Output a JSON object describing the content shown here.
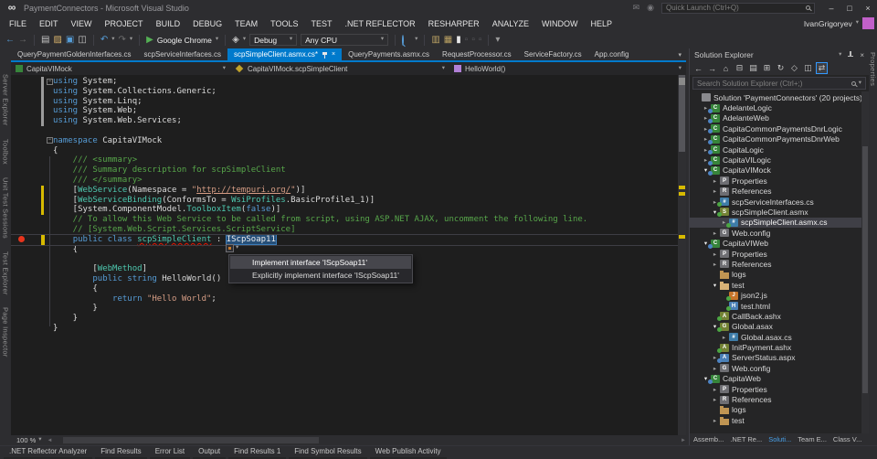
{
  "window": {
    "title": "PaymentConnectors - Microsoft Visual Studio"
  },
  "titlebar": {
    "quick_launch_placeholder": "Quick Launch (Ctrl+Q)"
  },
  "user": {
    "name": "IvanGrigoryev"
  },
  "menus": [
    "FILE",
    "EDIT",
    "VIEW",
    "PROJECT",
    "BUILD",
    "DEBUG",
    "TEAM",
    "TOOLS",
    "TEST",
    ".NET REFLECTOR",
    "RESHARPER",
    "ANALYZE",
    "WINDOW",
    "HELP"
  ],
  "toolbar": {
    "items": [
      {
        "k": "icon",
        "name": "navigate-back-icon",
        "g": "←",
        "tint": "#569CD6"
      },
      {
        "k": "icon",
        "name": "navigate-forward-icon",
        "g": "→",
        "tint": "#6E6E6E"
      },
      {
        "k": "sep"
      },
      {
        "k": "icon",
        "name": "new-file-icon",
        "g": "▤",
        "tint": "#C8C8C8"
      },
      {
        "k": "icon",
        "name": "open-file-icon",
        "g": "▨",
        "tint": "#D9B36C"
      },
      {
        "k": "icon",
        "name": "save-icon",
        "g": "▣",
        "tint": "#569CD6"
      },
      {
        "k": "icon",
        "name": "save-all-icon",
        "g": "◫",
        "tint": "#C8C8C8"
      },
      {
        "k": "sep"
      },
      {
        "k": "icon",
        "name": "undo-icon",
        "g": "↶",
        "tint": "#569CD6"
      },
      {
        "k": "caret"
      },
      {
        "k": "icon",
        "name": "redo-icon",
        "g": "↷",
        "tint": "#6E6E6E"
      },
      {
        "k": "caret"
      },
      {
        "k": "sep"
      },
      {
        "k": "icon",
        "name": "start-debug-icon",
        "g": "▶",
        "tint": "#54B054"
      },
      {
        "k": "runlabel",
        "label": "Google Chrome"
      },
      {
        "k": "caret"
      },
      {
        "k": "sep"
      },
      {
        "k": "icon",
        "name": "browse-with-icon",
        "g": "◈",
        "tint": "#C8C8C8"
      },
      {
        "k": "caret"
      },
      {
        "k": "combo",
        "name": "solution-configuration-dropdown",
        "label": "Debug",
        "w": 52
      },
      {
        "k": "combo",
        "name": "solution-platform-dropdown",
        "label": "Any CPU",
        "w": 96
      },
      {
        "k": "sep"
      },
      {
        "k": "mag",
        "name": "find-in-files-icon"
      },
      {
        "k": "caret"
      },
      {
        "k": "sep"
      },
      {
        "k": "icon",
        "name": "solution-scope-icon",
        "g": "▥",
        "tint": "#B9A063"
      },
      {
        "k": "icon",
        "name": "file-scope-icon",
        "g": "▦",
        "tint": "#B9A063"
      },
      {
        "k": "icon",
        "name": "bookmark-icon",
        "g": "▮",
        "tint": "#E8E8E8"
      },
      {
        "k": "icon",
        "name": "comment-icon",
        "g": "▫",
        "tint": "#5E5E63"
      },
      {
        "k": "icon",
        "name": "uncomment-icon",
        "g": "▫",
        "tint": "#5E5E63"
      },
      {
        "k": "icon",
        "name": "indent-icon",
        "g": "▫",
        "tint": "#5E5E63"
      },
      {
        "k": "sep"
      },
      {
        "k": "icon",
        "name": "toolbar-overflow-icon",
        "g": "▾",
        "tint": "#999999"
      }
    ]
  },
  "left_tool_tabs": [
    "Server Explorer",
    "Toolbox",
    "Unit Test Sessions",
    "Test Explorer",
    "Page Inspector"
  ],
  "right_tool_tabs": [
    "Properties"
  ],
  "doc_tabs": [
    {
      "label": "QueryPaymentGoldenInterfaces.cs",
      "active": false
    },
    {
      "label": "scpServiceInterfaces.cs",
      "active": false
    },
    {
      "label": "scpSimpleClient.asmx.cs*",
      "active": true
    },
    {
      "label": "QueryPayments.asmx.cs",
      "active": false
    },
    {
      "label": "RequestProcessor.cs",
      "active": false
    },
    {
      "label": "ServiceFactory.cs",
      "active": false
    },
    {
      "label": "App.config",
      "active": false
    }
  ],
  "breadcrumb": {
    "project": "CapitaVIMock",
    "type_name": "CapitaVIMock.scpSimpleClient",
    "member": "HelloWorld()"
  },
  "editor": {
    "zoom_label": "100 %",
    "current_line_index": 16,
    "code_lines": [
      [
        {
          "t": "using",
          "c": "kw"
        },
        {
          "t": " System;",
          "c": "pl"
        }
      ],
      [
        {
          "t": "using",
          "c": "kw"
        },
        {
          "t": " System.Collections.Generic;",
          "c": "pl"
        }
      ],
      [
        {
          "t": "using",
          "c": "kw"
        },
        {
          "t": " System.Linq;",
          "c": "pl"
        }
      ],
      [
        {
          "t": "using",
          "c": "kw"
        },
        {
          "t": " System.Web;",
          "c": "pl"
        }
      ],
      [
        {
          "t": "using",
          "c": "kw"
        },
        {
          "t": " System.Web.Services;",
          "c": "pl"
        }
      ],
      [],
      [
        {
          "t": "namespace",
          "c": "kw"
        },
        {
          "t": " CapitaVIMock",
          "c": "pl"
        }
      ],
      [
        {
          "t": "{",
          "c": "pl"
        }
      ],
      [
        {
          "t": "    /// <summary>",
          "c": "cm"
        }
      ],
      [
        {
          "t": "    /// Summary description for scpSimpleClient",
          "c": "cm"
        }
      ],
      [
        {
          "t": "    /// </summary>",
          "c": "cm"
        }
      ],
      [
        {
          "t": "    [",
          "c": "pl"
        },
        {
          "t": "WebService",
          "c": "ty"
        },
        {
          "t": "(Namespace = ",
          "c": "pl"
        },
        {
          "t": "\"",
          "c": "st"
        },
        {
          "t": "http://tempuri.org/",
          "c": "lk"
        },
        {
          "t": "\"",
          "c": "st"
        },
        {
          "t": ")]",
          "c": "pl"
        }
      ],
      [
        {
          "t": "    [",
          "c": "pl"
        },
        {
          "t": "WebServiceBinding",
          "c": "ty"
        },
        {
          "t": "(ConformsTo = ",
          "c": "pl"
        },
        {
          "t": "WsiProfiles",
          "c": "ty"
        },
        {
          "t": ".BasicProfile1_1)]",
          "c": "pl"
        }
      ],
      [
        {
          "t": "    [System.ComponentModel.",
          "c": "pl"
        },
        {
          "t": "ToolboxItem",
          "c": "ty"
        },
        {
          "t": "(",
          "c": "pl"
        },
        {
          "t": "false",
          "c": "kw"
        },
        {
          "t": ")]",
          "c": "pl"
        }
      ],
      [
        {
          "t": "    // To allow this Web Service to be called from script, using ASP.NET AJAX, uncomment the following line.",
          "c": "cm"
        }
      ],
      [
        {
          "t": "    // [System.Web.Script.Services.ScriptService]",
          "c": "cm"
        }
      ],
      [
        {
          "t": "    ",
          "c": "pl"
        },
        {
          "t": "public class",
          "c": "kw"
        },
        {
          "t": " ",
          "c": "pl"
        },
        {
          "t": "scpSimpleClient",
          "c": "er"
        },
        {
          "t": " : ",
          "c": "pl"
        },
        {
          "t": "IScpSoap11",
          "c": "sl"
        }
      ],
      [
        {
          "t": "    {",
          "c": "pl"
        }
      ],
      [],
      [
        {
          "t": "        [",
          "c": "pl"
        },
        {
          "t": "WebMethod",
          "c": "ty"
        },
        {
          "t": "]",
          "c": "pl"
        }
      ],
      [
        {
          "t": "        ",
          "c": "pl"
        },
        {
          "t": "public string",
          "c": "kw"
        },
        {
          "t": " HelloWorld()",
          "c": "pl"
        }
      ],
      [
        {
          "t": "        {",
          "c": "pl"
        }
      ],
      [
        {
          "t": "            ",
          "c": "pl"
        },
        {
          "t": "return",
          "c": "kw"
        },
        {
          "t": " ",
          "c": "pl"
        },
        {
          "t": "\"Hello World\"",
          "c": "st"
        },
        {
          "t": ";",
          "c": "pl"
        }
      ],
      [
        {
          "t": "        }",
          "c": "pl"
        }
      ],
      [
        {
          "t": "    }",
          "c": "pl"
        }
      ],
      [
        {
          "t": "}",
          "c": "pl"
        }
      ]
    ]
  },
  "context_menu": {
    "items": [
      {
        "label": "Implement interface 'IScpSoap11'",
        "highlighted": true
      },
      {
        "label": "Explicitly implement interface 'IScpSoap11'",
        "highlighted": false
      }
    ]
  },
  "solution_explorer": {
    "title": "Solution Explorer",
    "search_placeholder": "Search Solution Explorer (Ctrl+;)",
    "toolbar_icons": [
      {
        "name": "back-icon",
        "g": "←"
      },
      {
        "name": "forward-icon",
        "g": "→"
      },
      {
        "name": "home-icon",
        "g": "⌂"
      },
      {
        "name": "collapse-all-icon",
        "g": "⊟"
      },
      {
        "name": "pending-changes-filter-icon",
        "g": "▤"
      },
      {
        "name": "show-all-files-icon",
        "g": "⊞"
      },
      {
        "name": "refresh-icon",
        "g": "↻"
      },
      {
        "name": "view-code-icon",
        "g": "◇"
      },
      {
        "name": "preview-selected-items-icon",
        "g": "◫"
      },
      {
        "name": "sync-with-active-document-icon",
        "g": "⇄",
        "boxed": true
      }
    ],
    "tree": [
      {
        "label": "Solution 'PaymentConnectors' (20 projects)",
        "depth": 0,
        "icon": "sln",
        "arrow": "",
        "sel": false,
        "dot": null
      },
      {
        "label": "AdelanteLogic",
        "depth": 1,
        "icon": "csproj",
        "arrow": "c",
        "sel": false,
        "dot": "blue"
      },
      {
        "label": "AdelanteWeb",
        "depth": 1,
        "icon": "webproj",
        "arrow": "c",
        "sel": false,
        "dot": "blue"
      },
      {
        "label": "CapitaCommonPaymentsDnrLogic",
        "depth": 1,
        "icon": "csproj",
        "arrow": "c",
        "sel": false,
        "dot": "blue"
      },
      {
        "label": "CapitaCommonPaymentsDnrWeb",
        "depth": 1,
        "icon": "webproj",
        "arrow": "c",
        "sel": false,
        "dot": "blue"
      },
      {
        "label": "CapitaLogic",
        "depth": 1,
        "icon": "csproj",
        "arrow": "c",
        "sel": false,
        "dot": "blue"
      },
      {
        "label": "CapitaVILogic",
        "depth": 1,
        "icon": "csproj",
        "arrow": "c",
        "sel": false,
        "dot": "blue"
      },
      {
        "label": "CapitaVIMock",
        "depth": 1,
        "icon": "webproj",
        "arrow": "e",
        "sel": false,
        "dot": "blue"
      },
      {
        "label": "Properties",
        "depth": 2,
        "icon": "props",
        "arrow": "c",
        "sel": false,
        "dot": null
      },
      {
        "label": "References",
        "depth": 2,
        "icon": "refs",
        "arrow": "c",
        "sel": false,
        "dot": null
      },
      {
        "label": "scpServiceInterfaces.cs",
        "depth": 2,
        "icon": "cs",
        "arrow": "c",
        "sel": false,
        "dot": "green"
      },
      {
        "label": "scpSimpleClient.asmx",
        "depth": 2,
        "icon": "asmx",
        "arrow": "e",
        "sel": false,
        "dot": "green"
      },
      {
        "label": "scpSimpleClient.asmx.cs",
        "depth": 3,
        "icon": "cs",
        "arrow": "c",
        "sel": true,
        "dot": "green"
      },
      {
        "label": "Web.config",
        "depth": 2,
        "icon": "config",
        "arrow": "c",
        "sel": false,
        "dot": null
      },
      {
        "label": "CapitaVIWeb",
        "depth": 1,
        "icon": "webproj",
        "arrow": "e",
        "sel": false,
        "dot": "blue"
      },
      {
        "label": "Properties",
        "depth": 2,
        "icon": "props",
        "arrow": "c",
        "sel": false,
        "dot": null
      },
      {
        "label": "References",
        "depth": 2,
        "icon": "refs",
        "arrow": "c",
        "sel": false,
        "dot": null
      },
      {
        "label": "logs",
        "depth": 2,
        "icon": "folder",
        "arrow": "",
        "sel": false,
        "dot": null
      },
      {
        "label": "test",
        "depth": 2,
        "icon": "folderopen",
        "arrow": "e",
        "sel": false,
        "dot": null
      },
      {
        "label": "json2.js",
        "depth": 3,
        "icon": "js",
        "arrow": "",
        "sel": false,
        "dot": "green"
      },
      {
        "label": "test.html",
        "depth": 3,
        "icon": "html",
        "arrow": "",
        "sel": false,
        "dot": "green"
      },
      {
        "label": "CallBack.ashx",
        "depth": 2,
        "icon": "ashx",
        "arrow": "",
        "sel": false,
        "dot": "green"
      },
      {
        "label": "Global.asax",
        "depth": 2,
        "icon": "asax",
        "arrow": "e",
        "sel": false,
        "dot": "green"
      },
      {
        "label": "Global.asax.cs",
        "depth": 3,
        "icon": "cs",
        "arrow": "c",
        "sel": false,
        "dot": null
      },
      {
        "label": "InitPayment.ashx",
        "depth": 2,
        "icon": "ashx",
        "arrow": "",
        "sel": false,
        "dot": "green"
      },
      {
        "label": "ServerStatus.aspx",
        "depth": 2,
        "icon": "aspx",
        "arrow": "c",
        "sel": false,
        "dot": "blue"
      },
      {
        "label": "Web.config",
        "depth": 2,
        "icon": "config",
        "arrow": "c",
        "sel": false,
        "dot": null
      },
      {
        "label": "CapitaWeb",
        "depth": 1,
        "icon": "webproj",
        "arrow": "e",
        "sel": false,
        "dot": "blue"
      },
      {
        "label": "Properties",
        "depth": 2,
        "icon": "props",
        "arrow": "c",
        "sel": false,
        "dot": null
      },
      {
        "label": "References",
        "depth": 2,
        "icon": "refs",
        "arrow": "c",
        "sel": false,
        "dot": null
      },
      {
        "label": "logs",
        "depth": 2,
        "icon": "folder",
        "arrow": "",
        "sel": false,
        "dot": null
      },
      {
        "label": "test",
        "depth": 2,
        "icon": "folder",
        "arrow": "c",
        "sel": false,
        "dot": null
      }
    ],
    "bottom_tabs": [
      {
        "label": "Assemb...",
        "active": false
      },
      {
        "label": ".NET Re...",
        "active": false
      },
      {
        "label": "Soluti...",
        "active": true
      },
      {
        "label": "Team E...",
        "active": false
      },
      {
        "label": "Class V...",
        "active": false
      }
    ]
  },
  "bottom_panel_tabs": [
    ".NET Reflector Analyzer",
    "Find Results",
    "Error List",
    "Output",
    "Find Results 1",
    "Find Symbol Results",
    "Web Publish Activity"
  ],
  "colors": {
    "accent": "#007ACC",
    "editor_background": "#1E1E1E",
    "chrome_background": "#2D2D30",
    "panel_background": "#252526",
    "keyword": "#569CD6",
    "type": "#4EC9B0",
    "string": "#D69D85",
    "comment": "#57A64A",
    "selection": "#264F78",
    "error_red": "#E51400",
    "change_bar_yellow": "#D7BA00",
    "avatar_purple": "#C160C9"
  }
}
